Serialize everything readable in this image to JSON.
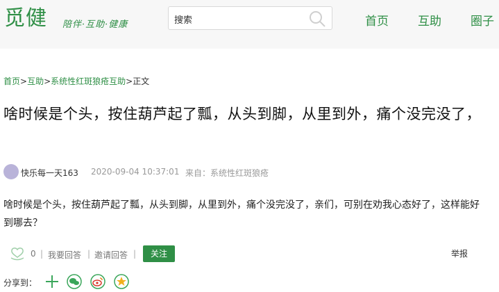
{
  "header": {
    "logo": "觅健",
    "slogan": "陪伴·互助·健康",
    "search_placeholder": "搜索",
    "nav": [
      "首页",
      "互助",
      "圈子"
    ]
  },
  "breadcrumb": {
    "items": [
      "首页",
      "互助",
      "系统性红斑狼疮互助",
      "正文"
    ]
  },
  "post": {
    "title": "啥时候是个头，按住葫芦起了瓢，从头到脚，从里到外，痛个没完没了，",
    "author": "快乐每一天163",
    "time": "2020-09-04 10:37:01",
    "source": "来自：系统性红斑狼疮",
    "body": "啥时候是个头，按住葫芦起了瓢，从头到脚，从里到外，痛个没完没了，亲们，可别在劝我心态好了，这样能好到哪去？"
  },
  "actions": {
    "like_count": "0",
    "answer_label": "我要回答",
    "invite_label": "邀请回答",
    "follow_label": "关注",
    "report_label": "举报"
  },
  "share": {
    "label": "分享到：",
    "icons": [
      "plus-icon",
      "wechat-icon",
      "weibo-icon",
      "qzone-icon"
    ]
  },
  "colors": {
    "brand": "#2f8f46",
    "avatar": "#b9b3d9"
  }
}
